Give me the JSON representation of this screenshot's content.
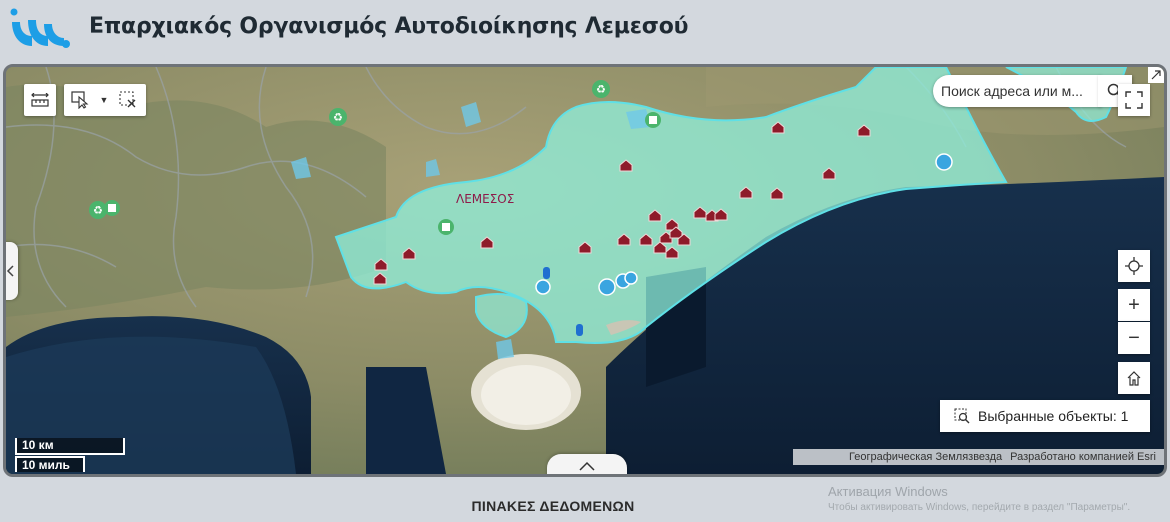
{
  "app": {
    "title": "Επαρχιακός Οργανισμός Αυτοδιοίκησης Λεμεσού",
    "brand_color": "#1d9ee6"
  },
  "map": {
    "place_label": "ΛΕΜΕΣΟΣ",
    "search_placeholder": "Поиск адреса или м...",
    "selected_objects_label": "Выбранные объекты: 1",
    "scale_km": "10 км",
    "scale_mi": "10 миль",
    "attribution_source": "Географическая Землязвезда",
    "attribution_credit": "Разработано компанией Esri",
    "region_fill_color": "#8ff0dc",
    "region_outline_color": "#5fe0e6",
    "house_marker_color": "#8e1b2a"
  },
  "toolbar": {
    "icons": [
      "measure-icon",
      "select-tool-icon",
      "chevron-down-icon",
      "clear-selection-icon"
    ]
  },
  "controls": {
    "icons": [
      "search-icon",
      "fullscreen-icon",
      "locate-icon",
      "zoom-in-icon",
      "zoom-out-icon",
      "home-icon",
      "expand-corner-icon"
    ],
    "zoom_in": "+",
    "zoom_out": "−"
  },
  "footer": {
    "data_tables_title": "ΠΙΝΑΚΕΣ ΔΕΔΟΜΕΝΩΝ"
  },
  "watermark": {
    "line1": "Активация Windows",
    "line2": "Чтобы активировать Windows, перейдите в раздел \"Параметры\"."
  }
}
